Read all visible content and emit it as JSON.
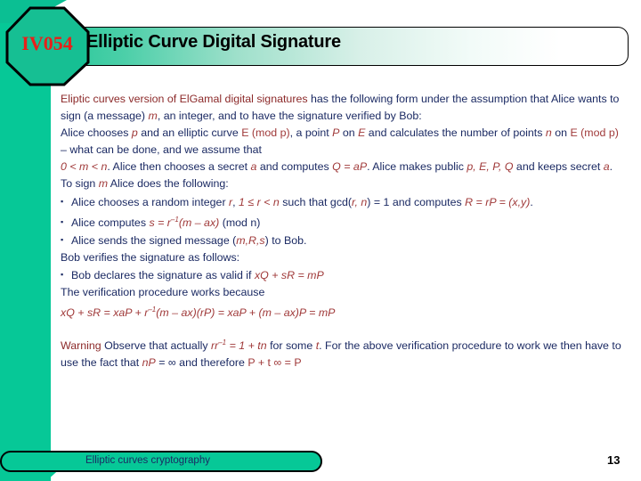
{
  "slide": {
    "badge": "IV054",
    "title": "Elliptic Curve Digital Signature",
    "footer_label": "Elliptic curves cryptography",
    "page_number": "13",
    "accent_green": "#06c897",
    "badge_text_color": "#e8201a",
    "body_text_color": "#1b2a63",
    "math_text_color": "#a03a3a"
  },
  "body": {
    "p1_a": "Eliptic curves version of ElGamal digital signatures",
    "p1_b": " has the following form under the assumption that Alice wants to sign (a message) ",
    "p1_m": "m",
    "p1_c": ", an integer, and to have the signature verified by Bob:",
    "p2_a": "Alice chooses ",
    "p2_p": "p",
    "p2_b": " and an elliptic curve ",
    "p2_Emodp": "E (mod p)",
    "p2_c": ", a point ",
    "p2_P": "P",
    "p2_d": " on ",
    "p2_E": "E",
    "p2_e": " and calculates the number of points ",
    "p2_n": "n",
    "p2_f": " on ",
    "p2_Emodp2": "E (mod p)",
    "p2_g": " – what can be done, and we assume that",
    "p3_range": "0 < m < n",
    "p3_a": ". Alice then chooses a secret ",
    "p3_aa": "a",
    "p3_b": " and computes ",
    "p3_Q": "Q = aP",
    "p3_c": ". Alice makes public ",
    "p3_pub": "p, E, P, Q",
    "p3_d": " and keeps secret ",
    "p3_sec": "a",
    "p3_e": ".",
    "p4_a": "To sign ",
    "p4_m": "m",
    "p4_b": " Alice does the following:",
    "b1_a": "Alice chooses a random integer ",
    "b1_r": "r",
    "b1_b": ", ",
    "b1_range": "1 ≤ r < n",
    "b1_c": " such that gcd(",
    "b1_gcd": "r, n",
    "b1_d": ") = 1 and computes ",
    "b1_R": "R = rP = (x,y)",
    "b1_e": ".",
    "b2_a": "Alice computes ",
    "b2_s": "s = r",
    "b2_sup": "–1",
    "b2_s2": "(m – ax)",
    "b2_mod": " (mod n)",
    "b3_a": "Alice sends the signed message (",
    "b3_mrs": "m,R,s",
    "b3_b": ") to Bob.",
    "p5": "Bob verifies the signature as follows:",
    "b4_a": "Bob declares the signature as valid if ",
    "b4_eq": "xQ + sR = mP",
    "p6": "The verification procedure works because",
    "p7_eq1": "xQ + sR = xaP + r",
    "p7_sup": "–1",
    "p7_eq2": "(m – ax)(rP) = xaP + (m – ax)P = mP",
    "w_label": "Warning",
    "w_a": " Observe that actually ",
    "w_rr": "rr",
    "w_sup": "–1",
    "w_b": " = 1 + ",
    "w_tn": "tn",
    "w_c": " for some ",
    "w_t": "t",
    "w_d": ". For the above verification procedure to work we then have to use the fact that ",
    "w_nP": "nP",
    "w_e": " = ∞ and therefore ",
    "w_PtP": "P + t ∞ = P"
  }
}
